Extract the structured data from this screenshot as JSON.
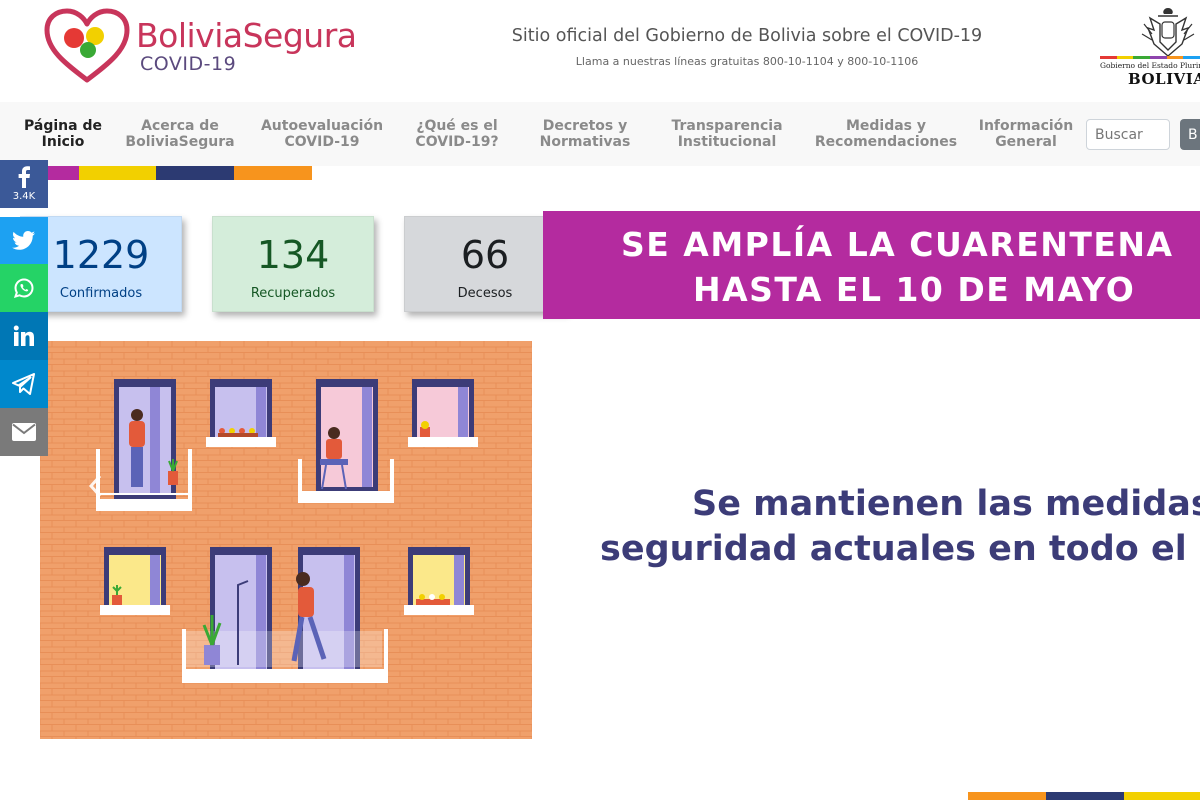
{
  "header": {
    "logo_name": "BoliviaSegura",
    "logo_sub": "COVID-19",
    "site_title": "Sitio oficial del Gobierno de Bolivia sobre el COVID-19",
    "phones": "Llama a nuestras líneas gratuitas 800-10-1104 y 800-10-1106",
    "gov_line": "Gobierno del Estado Plurinacional de",
    "gov_country": "BOLIVIA"
  },
  "nav": {
    "items": [
      {
        "line1": "Página de",
        "line2": "Inicio",
        "active": true
      },
      {
        "line1": "Acerca de",
        "line2": "BoliviaSegura"
      },
      {
        "line1": "Autoevaluación",
        "line2": "COVID-19"
      },
      {
        "line1": "¿Qué es el",
        "line2": "COVID-19?"
      },
      {
        "line1": "Decretos y",
        "line2": "Normativas"
      },
      {
        "line1": "Transparencia",
        "line2": "Institucional"
      },
      {
        "line1": "Medidas y",
        "line2": "Recomendaciones"
      },
      {
        "line1": "Información",
        "line2": "General"
      }
    ],
    "search_placeholder": "Buscar",
    "search_button": "B"
  },
  "social": {
    "facebook_count": "3.4K",
    "icons": [
      "facebook-icon",
      "twitter-icon",
      "whatsapp-icon",
      "linkedin-icon",
      "telegram-icon",
      "email-icon"
    ],
    "colors": {
      "facebook": "#3b5998",
      "twitter": "#1da1f2",
      "whatsapp": "#25d366",
      "linkedin": "#0077b5",
      "telegram": "#0088cc",
      "email": "#7a7a7a"
    }
  },
  "stats": {
    "confirmed": {
      "value": "1229",
      "label": "Confirmados",
      "bg": "#cce5ff",
      "color": "#004085"
    },
    "recovered": {
      "value": "134",
      "label": "Recuperados",
      "bg": "#d4edda",
      "color": "#155724"
    },
    "deaths": {
      "value": "66",
      "label": "Decesos",
      "bg": "#d6d8db",
      "color": "#1b1e21"
    }
  },
  "banner": {
    "line1": "SE AMPLÍA LA CUARENTENA",
    "line2": "HASTA EL 10 DE MAYO"
  },
  "message": {
    "line1": "Se mantienen las medidas de",
    "line2": "seguridad actuales en todo el país"
  },
  "stripe_colors": [
    "#b42b9f",
    "#f2d000",
    "#2c3a72",
    "#f7941d"
  ]
}
